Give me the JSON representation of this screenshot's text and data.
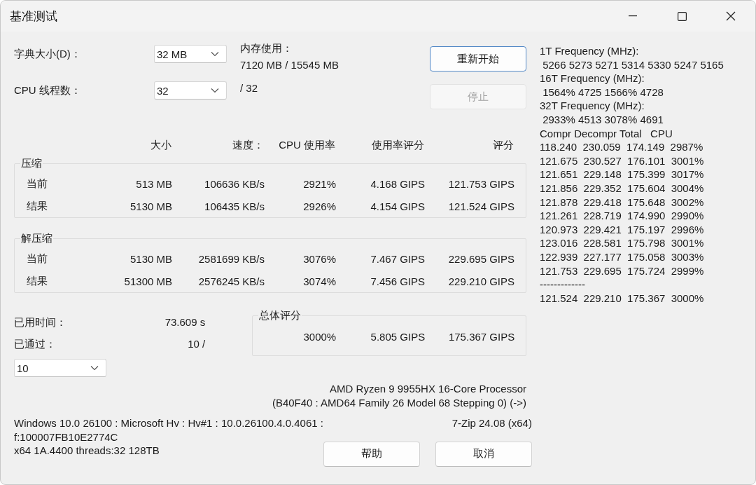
{
  "window": {
    "title": "基准测试"
  },
  "dictionary": {
    "label": "字典大小(D)：",
    "value": "32 MB"
  },
  "threads": {
    "label": "CPU 线程数：",
    "value": "32",
    "suffix": "/ 32"
  },
  "memory": {
    "label": "内存使用：",
    "value": "7120 MB / 15545 MB"
  },
  "actions": [
    {
      "label": "重新开始",
      "disabled": false,
      "default": true
    },
    {
      "label": "停止",
      "disabled": true,
      "default": false
    }
  ],
  "columns": [
    "大小",
    "速度：",
    "CPU 使用率",
    "使用率评分",
    "评分"
  ],
  "groups": [
    {
      "title": "压缩",
      "rows": [
        {
          "label": "当前",
          "cells": [
            "513 MB",
            "106636 KB/s",
            "2921%",
            "4.168 GIPS",
            "121.753 GIPS"
          ]
        },
        {
          "label": "结果",
          "cells": [
            "5130 MB",
            "106435 KB/s",
            "2926%",
            "4.154 GIPS",
            "121.524 GIPS"
          ]
        }
      ]
    },
    {
      "title": "解压缩",
      "rows": [
        {
          "label": "当前",
          "cells": [
            "5130 MB",
            "2581699 KB/s",
            "3076%",
            "7.467 GIPS",
            "229.695 GIPS"
          ]
        },
        {
          "label": "结果",
          "cells": [
            "51300 MB",
            "2576245 KB/s",
            "3074%",
            "7.456 GIPS",
            "229.210 GIPS"
          ]
        }
      ]
    }
  ],
  "elapsed": {
    "label": "已用时间：",
    "value": "73.609 s"
  },
  "passes": {
    "label": "已通过：",
    "value": "10 /",
    "combo": "10"
  },
  "total": {
    "title": "总体评分",
    "cells": [
      "3000%",
      "5.805 GIPS",
      "175.367 GIPS"
    ]
  },
  "cpu": [
    "AMD Ryzen 9 9955HX 16-Core Processor",
    "(B40F40 : AMD64 Family 26 Model 68 Stepping 0) (->)"
  ],
  "system": [
    "Windows 10.0 26100 : Microsoft Hv : Hv#1 : 10.0.26100.4.0.4061 :",
    "f:100007FB10E2774C",
    "x64 1A.4400 threads:32 128TB"
  ],
  "version": "7-Zip 24.08 (x64)",
  "bottom_buttons": [
    "帮助",
    "取消"
  ],
  "log": [
    "1T Frequency (MHz):",
    " 5266 5273 5271 5314 5330 5247 5165",
    "16T Frequency (MHz):",
    " 1564% 4725 1566% 4728",
    "32T Frequency (MHz):",
    " 2933% 4513 3078% 4691",
    "Compr Decompr Total   CPU",
    "118.240  230.059  174.149  2987%",
    "121.675  230.527  176.101  3001%",
    "121.651  229.148  175.399  3017%",
    "121.856  229.352  175.604  3004%",
    "121.878  229.418  175.648  3002%",
    "121.261  228.719  174.990  2990%",
    "120.973  229.421  175.197  2996%",
    "123.016  228.581  175.798  3001%",
    "122.939  227.177  175.058  3003%",
    "121.753  229.695  175.724  2999%",
    "-------------",
    "121.524  229.210  175.367  3000%"
  ]
}
